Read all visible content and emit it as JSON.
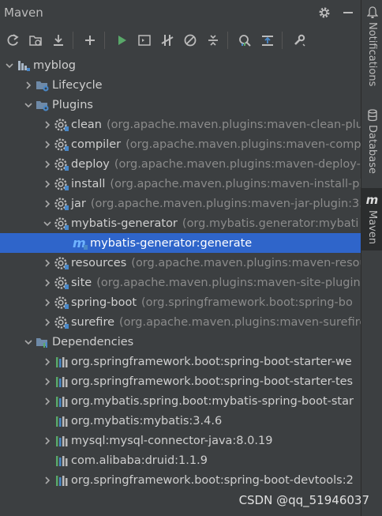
{
  "panel": {
    "title": "Maven",
    "title_actions": [
      "gear-icon",
      "minimize-icon"
    ]
  },
  "toolbar": {
    "buttons": [
      {
        "icon": "reload-icon"
      },
      {
        "icon": "generate-sources-icon"
      },
      {
        "icon": "download-icon"
      },
      {
        "icon": "add-icon"
      },
      {
        "icon": "run-icon",
        "color": "#59a869"
      },
      {
        "icon": "execute-goal-icon"
      },
      {
        "icon": "toggle-offline-icon"
      },
      {
        "icon": "skip-tests-icon"
      },
      {
        "icon": "collapse-all-icon"
      },
      {
        "icon": "show-dependencies-icon"
      },
      {
        "icon": "analyze-dependencies-icon"
      },
      {
        "icon": "settings-wrench-icon"
      }
    ]
  },
  "tree": {
    "rows": [
      {
        "level": 0,
        "expand": "open",
        "icon": "maven-project",
        "label": "myblog",
        "desc": ""
      },
      {
        "level": 1,
        "expand": "closed",
        "icon": "folder-gear",
        "label": "Lifecycle",
        "desc": ""
      },
      {
        "level": 1,
        "expand": "open",
        "icon": "folder-gear",
        "label": "Plugins",
        "desc": ""
      },
      {
        "level": 2,
        "expand": "closed",
        "icon": "plugin",
        "label": "clean",
        "desc": "(org.apache.maven.plugins:maven-clean-plu"
      },
      {
        "level": 2,
        "expand": "closed",
        "icon": "plugin",
        "label": "compiler",
        "desc": "(org.apache.maven.plugins:maven-comp"
      },
      {
        "level": 2,
        "expand": "closed",
        "icon": "plugin",
        "label": "deploy",
        "desc": "(org.apache.maven.plugins:maven-deploy-"
      },
      {
        "level": 2,
        "expand": "closed",
        "icon": "plugin",
        "label": "install",
        "desc": "(org.apache.maven.plugins:maven-install-pl"
      },
      {
        "level": 2,
        "expand": "closed",
        "icon": "plugin",
        "label": "jar",
        "desc": "(org.apache.maven.plugins:maven-jar-plugin:3."
      },
      {
        "level": 2,
        "expand": "open",
        "icon": "plugin",
        "label": "mybatis-generator",
        "desc": "(org.mybatis.generator:mybati"
      },
      {
        "level": 3,
        "expand": "none",
        "icon": "goal",
        "label": "mybatis-generator:generate",
        "desc": "",
        "selected": true
      },
      {
        "level": 2,
        "expand": "closed",
        "icon": "plugin",
        "label": "resources",
        "desc": "(org.apache.maven.plugins:maven-resou"
      },
      {
        "level": 2,
        "expand": "closed",
        "icon": "plugin",
        "label": "site",
        "desc": "(org.apache.maven.plugins:maven-site-plugin"
      },
      {
        "level": 2,
        "expand": "closed",
        "icon": "plugin",
        "label": "spring-boot",
        "desc": "(org.springframework.boot:spring-bo"
      },
      {
        "level": 2,
        "expand": "closed",
        "icon": "plugin",
        "label": "surefire",
        "desc": "(org.apache.maven.plugins:maven-surefire"
      },
      {
        "level": 1,
        "expand": "open",
        "icon": "folder-deps",
        "label": "Dependencies",
        "desc": ""
      },
      {
        "level": 2,
        "expand": "closed",
        "icon": "library",
        "label": "org.springframework.boot:spring-boot-starter-we",
        "desc": ""
      },
      {
        "level": 2,
        "expand": "closed",
        "icon": "library",
        "label": "org.springframework.boot:spring-boot-starter-tes",
        "desc": ""
      },
      {
        "level": 2,
        "expand": "closed",
        "icon": "library",
        "label": "org.mybatis.spring.boot:mybatis-spring-boot-star",
        "desc": ""
      },
      {
        "level": 2,
        "expand": "none",
        "icon": "library",
        "label": "org.mybatis:mybatis:3.4.6",
        "desc": ""
      },
      {
        "level": 2,
        "expand": "closed",
        "icon": "library",
        "label": "mysql:mysql-connector-java:8.0.19",
        "desc": ""
      },
      {
        "level": 2,
        "expand": "none",
        "icon": "library",
        "label": "com.alibaba:druid:1.1.9",
        "desc": ""
      },
      {
        "level": 2,
        "expand": "closed",
        "icon": "library",
        "label": "org.springframework.boot:spring-boot-devtools:2",
        "desc": ""
      }
    ]
  },
  "sidebar": {
    "tabs": [
      {
        "label": "Notifications",
        "icon": "bell-icon",
        "active": false
      },
      {
        "label": "Database",
        "icon": "database-icon",
        "active": false
      },
      {
        "label": "Maven",
        "icon": "maven-icon",
        "active": true
      }
    ]
  },
  "watermark": "CSDN @qq_51946037",
  "colors": {
    "background": "#3c3f41",
    "selection": "#2f65ca",
    "accent_blue": "#4a88c7",
    "run_green": "#59a869"
  }
}
